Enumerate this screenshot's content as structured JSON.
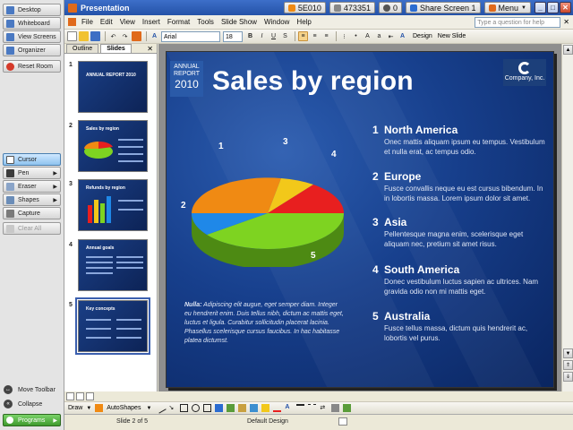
{
  "left_toolbar": {
    "top_items": [
      {
        "label": "Desktop",
        "icon": "desktop-icon",
        "color": "#4a79c2"
      },
      {
        "label": "Whiteboard",
        "icon": "whiteboard-icon",
        "color": "#4a79c2"
      },
      {
        "label": "View Screens",
        "icon": "view-screens-icon",
        "color": "#4a79c2"
      },
      {
        "label": "Organizer",
        "icon": "organizer-icon",
        "color": "#4a79c2"
      }
    ],
    "reset_room": "Reset Room",
    "tools": [
      {
        "label": "Cursor",
        "icon": "cursor-icon",
        "active": true,
        "arrow": false
      },
      {
        "label": "Pen",
        "icon": "pen-icon",
        "active": false,
        "arrow": true
      },
      {
        "label": "Eraser",
        "icon": "eraser-icon",
        "active": false,
        "arrow": true
      },
      {
        "label": "Shapes",
        "icon": "shapes-icon",
        "active": false,
        "arrow": true
      },
      {
        "label": "Capture",
        "icon": "capture-icon",
        "active": false,
        "arrow": false
      }
    ],
    "clear_all": "Clear All",
    "move_toolbar": "Move Toolbar",
    "collapse": "Collapse",
    "programs": "Programs"
  },
  "titlebar": {
    "title": "Presentation",
    "session_id": "5E010",
    "session_code": "473351",
    "participants": "0",
    "share_screen": "Share Screen 1",
    "menu": "Menu"
  },
  "menubar": {
    "items": [
      "File",
      "Edit",
      "View",
      "Insert",
      "Format",
      "Tools",
      "Slide Show",
      "Window",
      "Help"
    ],
    "help_placeholder": "Type a question for help"
  },
  "toolbar": {
    "font_name": "Arial",
    "font_size": "18",
    "design_label": "Design",
    "new_slide_label": "New Slide"
  },
  "panel": {
    "tabs": [
      "Outline",
      "Slides"
    ],
    "active_tab": "Slides",
    "thumbs": [
      {
        "num": "1",
        "title": "ANNUAL REPORT 2010"
      },
      {
        "num": "2",
        "title": "Sales by region"
      },
      {
        "num": "3",
        "title": "Refunds by region"
      },
      {
        "num": "4",
        "title": "Annual goals"
      },
      {
        "num": "5",
        "title": "Key concepts"
      }
    ]
  },
  "slide": {
    "badge_line1": "ANNUAL",
    "badge_line2": "REPORT",
    "badge_year": "2010",
    "title": "Sales by region",
    "logo_text": "Company, Inc.",
    "pie_labels": [
      "1",
      "2",
      "3",
      "4",
      "5"
    ],
    "pie_colors": [
      "#f08a13",
      "#1f88e8",
      "#f2c81a",
      "#e81f1f",
      "#7ed321"
    ],
    "note_bold": "Nulla:",
    "note_text": " Adipiscing elit augue, eget semper diam. Integer eu hendrerit enim. Duis tellus nibh, dictum ac mattis eget, luctus et ligula. Curabitur sollicitudin placerat lacinia. Phasellus scelerisque cursus faucibus. In hac habitasse platea dictumst.",
    "regions": [
      {
        "num": "1",
        "title": "North America",
        "desc": "Onec mattis aliquam ipsum eu tempus. Vestibulum et nulla erat, ac tempus odio."
      },
      {
        "num": "2",
        "title": "Europe",
        "desc": "Fusce convallis neque eu est cursus bibendum. In in lobortis massa. Lorem ipsum dolor sit amet."
      },
      {
        "num": "3",
        "title": "Asia",
        "desc": "Pellentesque magna enim, scelerisque eget aliquam nec, pretium sit amet risus."
      },
      {
        "num": "4",
        "title": "South America",
        "desc": "Donec vestibulum luctus sapien ac ultrices. Nam gravida odio non mi mattis eget."
      },
      {
        "num": "5",
        "title": "Australia",
        "desc": "Fusce tellus massa, dictum quis hendrerit ac, lobortis vel purus."
      }
    ]
  },
  "drawbar": {
    "draw_label": "Draw",
    "autoshapes_label": "AutoShapes"
  },
  "statusbar": {
    "slide_info": "Slide 2 of 5",
    "design": "Default Design"
  }
}
